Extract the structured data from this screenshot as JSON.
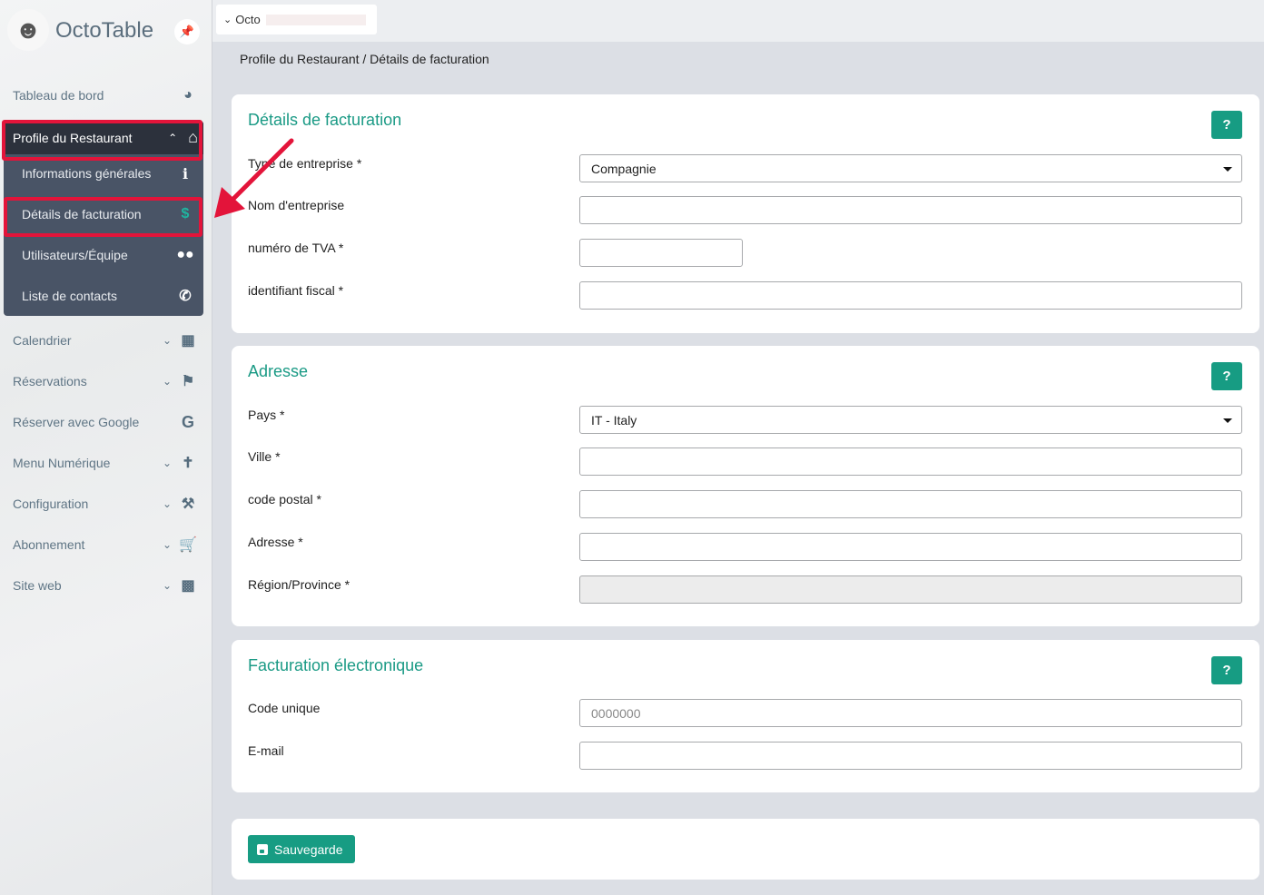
{
  "app": {
    "brand": "OctoTable"
  },
  "topbar": {
    "restaurant_selector": "Octo"
  },
  "breadcrumb": "Profile du Restaurant / Détails de facturation",
  "sidebar": {
    "dashboard": "Tableau de bord",
    "profile": {
      "label": "Profile du Restaurant",
      "items": [
        "Informations générales",
        "Détails de facturation",
        "Utilisateurs/Équipe",
        "Liste de contacts"
      ]
    },
    "items": [
      "Calendrier",
      "Réservations",
      "Réserver avec Google",
      "Menu Numérique",
      "Configuration",
      "Abonnement",
      "Site web"
    ]
  },
  "billing": {
    "title": "Détails de facturation",
    "help": "?",
    "fields": [
      {
        "label": "Type de entreprise  *",
        "value": "Compagnie"
      },
      {
        "label": "Nom d'entreprise",
        "value": ""
      },
      {
        "label": "numéro de TVA *",
        "value": ""
      },
      {
        "label": "identifiant fiscal *",
        "value": ""
      }
    ]
  },
  "address": {
    "title": "Adresse",
    "help": "?",
    "fields": [
      {
        "label": "Pays  *",
        "value": "IT - Italy"
      },
      {
        "label": "Ville  *",
        "value": ""
      },
      {
        "label": "code postal  *",
        "value": ""
      },
      {
        "label": "Adresse  *",
        "value": ""
      },
      {
        "label": "Région/Province  *",
        "value": ""
      }
    ]
  },
  "einvoice": {
    "title": "Facturation électronique",
    "help": "?",
    "fields": [
      {
        "label": "Code unique",
        "placeholder": "0000000"
      },
      {
        "label": "E-mail",
        "value": ""
      }
    ]
  },
  "save_label": "Sauvegarde",
  "colors": {
    "accent": "#179c83",
    "annotation": "#e3143a"
  }
}
